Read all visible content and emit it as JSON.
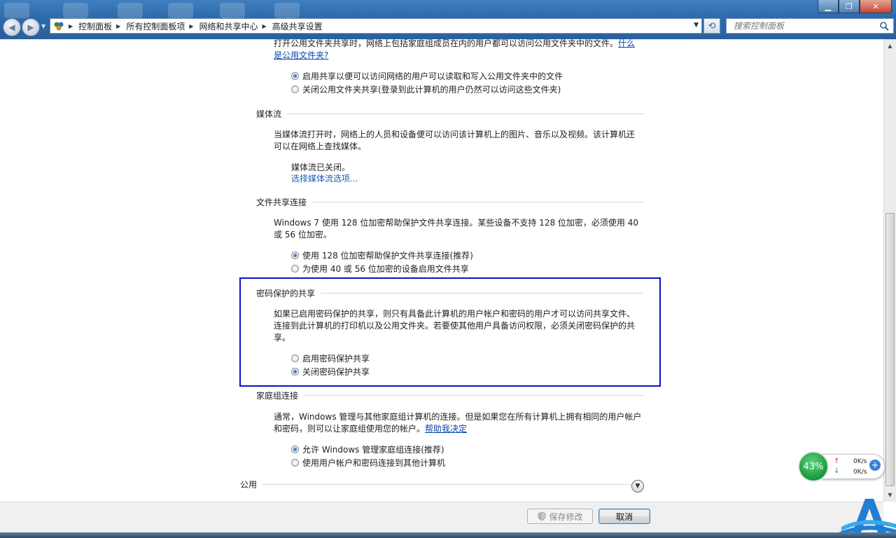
{
  "address_bar": {
    "breadcrumbs": [
      "控制面板",
      "所有控制面板项",
      "网络和共享中心",
      "高级共享设置"
    ]
  },
  "search": {
    "placeholder": "搜索控制面板"
  },
  "sections": {
    "public_folder": {
      "desc_before_link": "打开公用文件夹共享时，网络上包括家庭组成员在内的用户都可以访问公用文件夹中的文件。",
      "link": "什么是公用文件夹?",
      "options": [
        {
          "label": "启用共享以便可以访问网络的用户可以读取和写入公用文件夹中的文件",
          "selected": true
        },
        {
          "label": "关闭公用文件夹共享(登录到此计算机的用户仍然可以访问这些文件夹)",
          "selected": false
        }
      ]
    },
    "media_streaming": {
      "title": "媒体流",
      "desc": "当媒体流打开时，网络上的人员和设备便可以访问该计算机上的图片、音乐以及视频。该计算机还可以在网络上查找媒体。",
      "status": "媒体流已关闭。",
      "link": "选择媒体流选项..."
    },
    "file_sharing": {
      "title": "文件共享连接",
      "desc": "Windows 7 使用 128 位加密帮助保护文件共享连接。某些设备不支持 128 位加密，必须使用 40 或 56 位加密。",
      "options": [
        {
          "label": "使用 128 位加密帮助保护文件共享连接(推荐)",
          "selected": true
        },
        {
          "label": "为使用 40 或 56 位加密的设备启用文件共享",
          "selected": false
        }
      ]
    },
    "password_sharing": {
      "title": "密码保护的共享",
      "desc": "如果已启用密码保护的共享，则只有具备此计算机的用户帐户和密码的用户才可以访问共享文件、连接到此计算机的打印机以及公用文件夹。若要使其他用户具备访问权限，必须关闭密码保护的共享。",
      "options": [
        {
          "label": "启用密码保护共享",
          "selected": false
        },
        {
          "label": "关闭密码保护共享",
          "selected": true
        }
      ]
    },
    "homegroup": {
      "title": "家庭组连接",
      "desc_before_link": "通常，Windows 管理与其他家庭组计算机的连接。但是如果您在所有计算机上拥有相同的用户帐户和密码，则可以让家庭组使用您的帐户。",
      "link": "帮助我决定",
      "options": [
        {
          "label": "允许 Windows 管理家庭组连接(推荐)",
          "selected": true
        },
        {
          "label": "使用用户帐户和密码连接到其他计算机",
          "selected": false
        }
      ]
    },
    "public_profile": {
      "title": "公用"
    }
  },
  "footer": {
    "save_label": "保存修改",
    "cancel_label": "取消"
  },
  "gadget": {
    "percent": "43%",
    "upload": "0K/s",
    "download": "0K/s"
  },
  "colors": {
    "highlight_border": "#0a10c8",
    "link": "#0645ad"
  }
}
